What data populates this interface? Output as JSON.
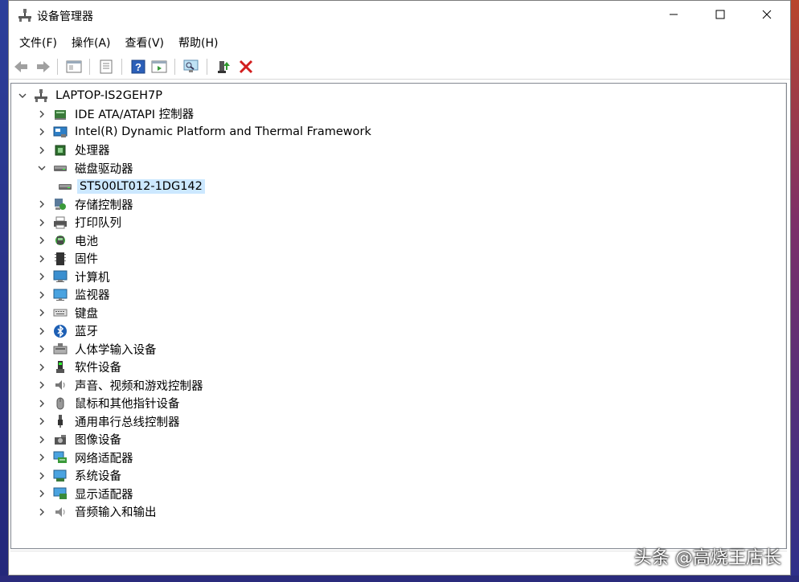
{
  "window": {
    "title": "设备管理器",
    "icon": "device-manager-icon"
  },
  "menu": [
    {
      "label": "文件(F)"
    },
    {
      "label": "操作(A)"
    },
    {
      "label": "查看(V)"
    },
    {
      "label": "帮助(H)"
    }
  ],
  "toolbar": [
    {
      "name": "back-arrow-icon"
    },
    {
      "name": "forward-arrow-icon"
    },
    {
      "name": "properties-icon"
    },
    {
      "name": "update-driver-icon"
    },
    {
      "name": "help-icon"
    },
    {
      "name": "action-pane-icon"
    },
    {
      "name": "scan-hardware-icon"
    },
    {
      "name": "add-driver-icon"
    },
    {
      "name": "uninstall-x-icon"
    }
  ],
  "tree": {
    "root": "LAPTOP-IS2GEH7P",
    "items": [
      {
        "label": "IDE ATA/ATAPI 控制器",
        "icon": "ide-controller-icon",
        "expanded": false
      },
      {
        "label": "Intel(R) Dynamic Platform and Thermal Framework",
        "icon": "intel-framework-icon",
        "expanded": false
      },
      {
        "label": "处理器",
        "icon": "processor-icon",
        "expanded": false
      },
      {
        "label": "磁盘驱动器",
        "icon": "disk-drive-icon",
        "expanded": true
      },
      {
        "label": "ST500LT012-1DG142",
        "icon": "disk-drive-icon",
        "child": true,
        "selected": true
      },
      {
        "label": "存储控制器",
        "icon": "storage-controller-icon",
        "expanded": false
      },
      {
        "label": "打印队列",
        "icon": "printer-icon",
        "expanded": false
      },
      {
        "label": "电池",
        "icon": "battery-icon",
        "expanded": false
      },
      {
        "label": "固件",
        "icon": "firmware-icon",
        "expanded": false
      },
      {
        "label": "计算机",
        "icon": "computer-icon",
        "expanded": false
      },
      {
        "label": "监视器",
        "icon": "monitor-icon",
        "expanded": false
      },
      {
        "label": "键盘",
        "icon": "keyboard-icon",
        "expanded": false
      },
      {
        "label": "蓝牙",
        "icon": "bluetooth-icon",
        "expanded": false
      },
      {
        "label": "人体学输入设备",
        "icon": "hid-icon",
        "expanded": false
      },
      {
        "label": "软件设备",
        "icon": "software-device-icon",
        "expanded": false
      },
      {
        "label": "声音、视频和游戏控制器",
        "icon": "sound-icon",
        "expanded": false
      },
      {
        "label": "鼠标和其他指针设备",
        "icon": "mouse-icon",
        "expanded": false
      },
      {
        "label": "通用串行总线控制器",
        "icon": "usb-icon",
        "expanded": false
      },
      {
        "label": "图像设备",
        "icon": "camera-icon",
        "expanded": false
      },
      {
        "label": "网络适配器",
        "icon": "network-adapter-icon",
        "expanded": false
      },
      {
        "label": "系统设备",
        "icon": "system-device-icon",
        "expanded": false
      },
      {
        "label": "显示适配器",
        "icon": "display-adapter-icon",
        "expanded": false
      },
      {
        "label": "音频输入和输出",
        "icon": "audio-io-icon",
        "expanded": false
      }
    ]
  },
  "watermark": "头条 @高烧王店长",
  "colors": {
    "selection": "#cce8ff",
    "accent": "#0078d7",
    "desktop": "#2b3a8f"
  }
}
